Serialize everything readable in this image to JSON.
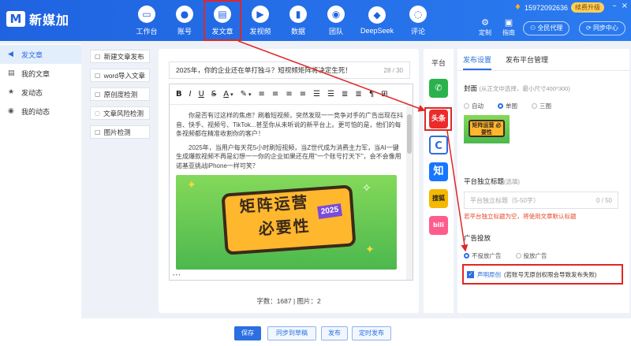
{
  "app": {
    "logo_mark": "M",
    "name": "新媒加"
  },
  "nav": [
    {
      "label": "工作台",
      "icon": "monitor-icon",
      "glyph": "▭"
    },
    {
      "label": "账号",
      "icon": "user-icon",
      "glyph": "●"
    },
    {
      "label": "发文章",
      "icon": "document-icon",
      "glyph": "▤",
      "active": true
    },
    {
      "label": "发视频",
      "icon": "video-icon",
      "glyph": "▶"
    },
    {
      "label": "数据",
      "icon": "bar-chart-icon",
      "glyph": "▮"
    },
    {
      "label": "团队",
      "icon": "team-icon",
      "glyph": "◉"
    },
    {
      "label": "DeepSeek",
      "icon": "deepseek-icon",
      "glyph": "◆"
    },
    {
      "label": "评论",
      "icon": "comment-icon",
      "glyph": "◌"
    }
  ],
  "header": {
    "phone": "15972092636",
    "renew_label": "续费升级",
    "custom_label": "定制",
    "guide_label": "指南",
    "agent_label": "全民代理",
    "sync_label": "同步中心"
  },
  "sidebar": [
    {
      "label": "发文章",
      "icon": "send-icon",
      "glyph": "◀",
      "active": true
    },
    {
      "label": "我的文章",
      "icon": "doc-list-icon",
      "glyph": "▤"
    },
    {
      "label": "发动态",
      "icon": "star-icon",
      "glyph": "★"
    },
    {
      "label": "我的动态",
      "icon": "dynamic-icon",
      "glyph": "◉"
    }
  ],
  "tools": [
    {
      "label": "新建文章发布",
      "icon": "new-doc-icon",
      "glyph": "▢"
    },
    {
      "label": "word导入文章",
      "icon": "word-import-icon",
      "glyph": "▢"
    },
    {
      "label": "原创度检测",
      "icon": "original-check-icon",
      "glyph": "▢"
    },
    {
      "label": "文章风险检测",
      "icon": "risk-check-icon",
      "glyph": "◌"
    },
    {
      "label": "图片检测",
      "icon": "image-check-icon",
      "glyph": "▢"
    }
  ],
  "editor": {
    "title": "2025年，你的企业还在单打独斗？短视频矩阵将决定生死！",
    "title_count": "28 / 30",
    "toolbar": [
      "B",
      "I",
      "U",
      "S",
      "A",
      "▾",
      "✎",
      "▾",
      "≡",
      "≡",
      "≡",
      "≡",
      "☰",
      "☰",
      "≣",
      "≣",
      "¶",
      "⊞"
    ],
    "para1": "你是否有过这样的焦虑？刷着短视频，突然发现一一竞争对手的广告出现在抖音、快手、视频号、TikTok...甚至你从未听说的新平台上。更可怕的是，他们的每条视频都在精准收割你的客户！",
    "para2": "2025年，当用户每天花5小时刷短视频，当Z世代成为消费主力军，当AI一键生成爆款视频不再是幻想一一你的企业如果还在用\"一个账号打天下\"，会不会像用诺基亚挑战iPhone一样可笑？",
    "cover_line1": "矩阵运营",
    "cover_line2": "必要性",
    "cover_year": "2025",
    "foot_dots": "• • •",
    "word_count": "字数：1687 | 图片：2"
  },
  "platforms": {
    "header": "平台",
    "items": [
      {
        "name": "wechat-icon",
        "glyph": "✆",
        "color": "#2bb24c"
      },
      {
        "name": "toutiao-icon",
        "glyph": "头条",
        "color": "#ed2a2a"
      },
      {
        "name": "c-platform-icon",
        "glyph": "C",
        "color": "#2b6fe0"
      },
      {
        "name": "zhihu-icon",
        "glyph": "知",
        "color": "#1677ff"
      },
      {
        "name": "sohu-icon",
        "glyph": "搜狐",
        "color": "#f5b800"
      },
      {
        "name": "bilibili-icon",
        "glyph": "bili",
        "color": "#ff5c8d"
      }
    ]
  },
  "panel": {
    "tab_settings": "发布设置",
    "tab_manage": "发布平台管理",
    "cover_label": "封面",
    "cover_hint": "(从正文中选择，最小尺寸400*300)",
    "cover_options": [
      "自动",
      "单图",
      "三图"
    ],
    "cover_selected": 1,
    "thumb_text": "矩阵运营 必要性",
    "title_label": "平台独立标题",
    "title_hint": "(选填)",
    "title_placeholder": "平台独立标题（5-50字）",
    "title_count": "0 / 50",
    "title_warning": "若平台独立标题为空，将使用文章默认标题",
    "ad_label": "广告投放",
    "ad_options": [
      "不投放广告",
      "投放广告"
    ],
    "ad_selected": 0,
    "original_label": "声明原创",
    "original_note": "(若账号无原创权限会导致发布失败)"
  },
  "footer": {
    "save": "保存",
    "sync_draft": "同步到草稿",
    "publish": "发布",
    "scheduled": "定时发布"
  }
}
